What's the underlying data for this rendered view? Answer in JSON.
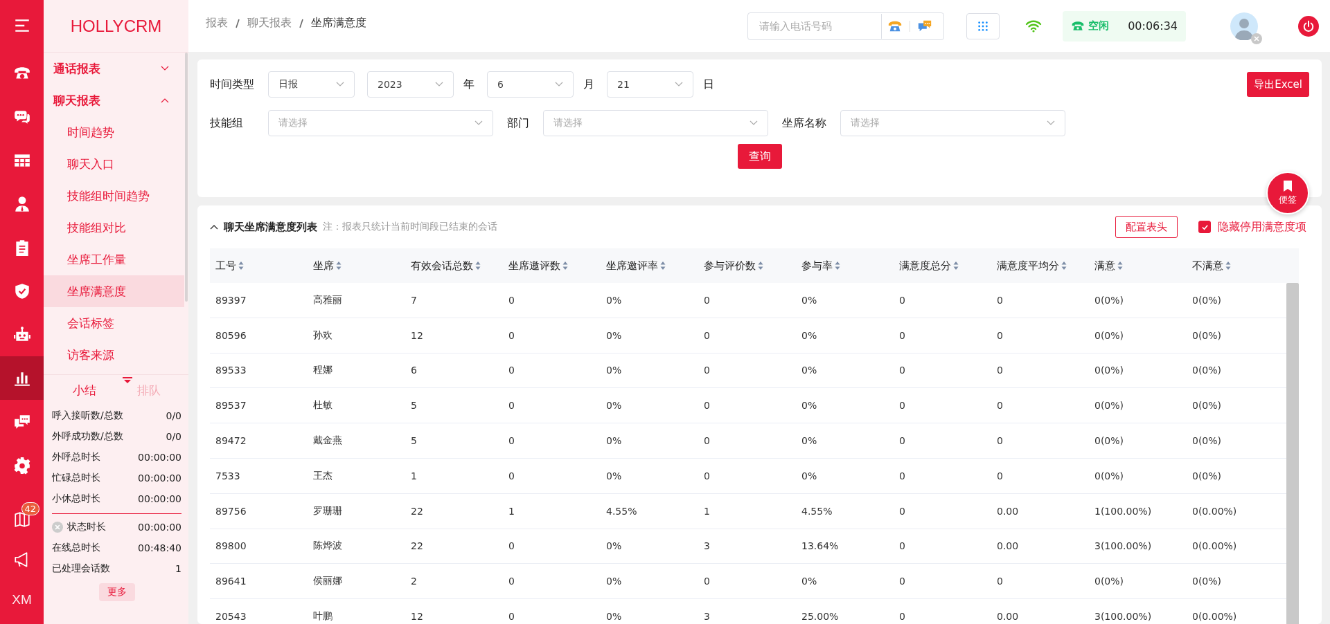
{
  "rail": {
    "items": [
      {
        "kind": "menu",
        "selected": false
      },
      {
        "kind": "phone",
        "selected": false
      },
      {
        "kind": "chat",
        "selected": false
      },
      {
        "kind": "grid",
        "selected": false
      },
      {
        "kind": "person",
        "selected": false
      },
      {
        "kind": "clipboard",
        "selected": false
      },
      {
        "kind": "shield",
        "selected": false
      },
      {
        "kind": "robot",
        "selected": false
      },
      {
        "kind": "chart",
        "selected": true
      },
      {
        "kind": "bubbles",
        "selected": false
      },
      {
        "kind": "gear",
        "selected": false
      }
    ],
    "bottom": [
      {
        "kind": "book",
        "badge": "42"
      },
      {
        "kind": "megaphone"
      },
      {
        "kind": "text",
        "label": "XM"
      }
    ]
  },
  "sidebar": {
    "logo": "HOLLYCRM",
    "groups": [
      {
        "label": "通话报表",
        "expanded": false
      },
      {
        "label": "聊天报表",
        "expanded": true,
        "children": [
          {
            "label": "时间趋势",
            "selected": false
          },
          {
            "label": "聊天入口",
            "selected": false
          },
          {
            "label": "技能组时间趋势",
            "selected": false
          },
          {
            "label": "技能组对比",
            "selected": false
          },
          {
            "label": "坐席工作量",
            "selected": false
          },
          {
            "label": "坐席满意度",
            "selected": true
          },
          {
            "label": "会话标签",
            "selected": false
          },
          {
            "label": "访客来源",
            "selected": false
          }
        ]
      }
    ]
  },
  "summary": {
    "tabs": [
      {
        "label": "小结",
        "selected": true
      },
      {
        "label": "排队",
        "selected": false
      }
    ],
    "stats": [
      {
        "label": "呼入接听数/总数",
        "value": "0/0"
      },
      {
        "label": "外呼成功数/总数",
        "value": "0/0"
      },
      {
        "label": "外呼总时长",
        "value": "00:00:00"
      },
      {
        "label": "忙碌总时长",
        "value": "00:00:00"
      },
      {
        "label": "小休总时长",
        "value": "00:00:00"
      }
    ],
    "stats_2": [
      {
        "label": "状态时长",
        "value": "00:00:00",
        "kind": "status"
      },
      {
        "label": "在线总时长",
        "value": "00:48:40",
        "kind": "plain"
      },
      {
        "label": "已处理会话数",
        "value": "1",
        "kind": "plain"
      }
    ],
    "more_button": "更多"
  },
  "topbar": {
    "breadcrumb": [
      "报表",
      "聊天报表",
      "坐席满意度"
    ],
    "phone_placeholder": "请输入电话号码",
    "status": {
      "label": "空闲",
      "time": "00:06:34"
    }
  },
  "filters": {
    "time_type": {
      "label": "时间类型",
      "value": "日报"
    },
    "year": {
      "value": "2023",
      "unit": "年"
    },
    "month": {
      "value": "6",
      "unit": "月"
    },
    "day": {
      "value": "21",
      "unit": "日"
    },
    "selects": [
      {
        "label": "技能组",
        "placeholder": "请选择"
      },
      {
        "label": "部门",
        "placeholder": "请选择"
      },
      {
        "label": "坐席名称",
        "placeholder": "请选择"
      }
    ],
    "query_button": "查询",
    "export_button": "导出Excel"
  },
  "note_button": "便签",
  "table": {
    "title": "聊天坐席满意度列表",
    "note": "注：报表只统计当前时间段已结束的会话",
    "config_button": "配置表头",
    "hide_disabled": {
      "label": "隐藏停用满意度项",
      "checked": true
    },
    "columns": [
      "工号",
      "坐席",
      "有效会话总数",
      "坐席邀评数",
      "坐席邀评率",
      "参与评价数",
      "参与率",
      "满意度总分",
      "满意度平均分",
      "满意",
      "不满意"
    ],
    "rows": [
      [
        "89397",
        "高雅丽",
        "7",
        "0",
        "0%",
        "0",
        "0%",
        "0",
        "0",
        "0(0%)",
        "0(0%)"
      ],
      [
        "80596",
        "孙欢",
        "12",
        "0",
        "0%",
        "0",
        "0%",
        "0",
        "0",
        "0(0%)",
        "0(0%)"
      ],
      [
        "89533",
        "程娜",
        "6",
        "0",
        "0%",
        "0",
        "0%",
        "0",
        "0",
        "0(0%)",
        "0(0%)"
      ],
      [
        "89537",
        "杜敏",
        "5",
        "0",
        "0%",
        "0",
        "0%",
        "0",
        "0",
        "0(0%)",
        "0(0%)"
      ],
      [
        "89472",
        "戴金燕",
        "5",
        "0",
        "0%",
        "0",
        "0%",
        "0",
        "0",
        "0(0%)",
        "0(0%)"
      ],
      [
        "7533",
        "王杰",
        "1",
        "0",
        "0%",
        "0",
        "0%",
        "0",
        "0",
        "0(0%)",
        "0(0%)"
      ],
      [
        "89756",
        "罗珊珊",
        "22",
        "1",
        "4.55%",
        "1",
        "4.55%",
        "0",
        "0.00",
        "1(100.00%)",
        "0(0.00%)"
      ],
      [
        "89800",
        "陈烨波",
        "22",
        "0",
        "0%",
        "3",
        "13.64%",
        "0",
        "0.00",
        "3(100.00%)",
        "0(0.00%)"
      ],
      [
        "89641",
        "侯丽娜",
        "2",
        "0",
        "0%",
        "0",
        "0%",
        "0",
        "0",
        "0(0%)",
        "0(0%)"
      ],
      [
        "20543",
        "叶鹏",
        "12",
        "0",
        "0%",
        "3",
        "25.00%",
        "0",
        "0.00",
        "3(100.00%)",
        "0(0.00%)"
      ]
    ]
  }
}
